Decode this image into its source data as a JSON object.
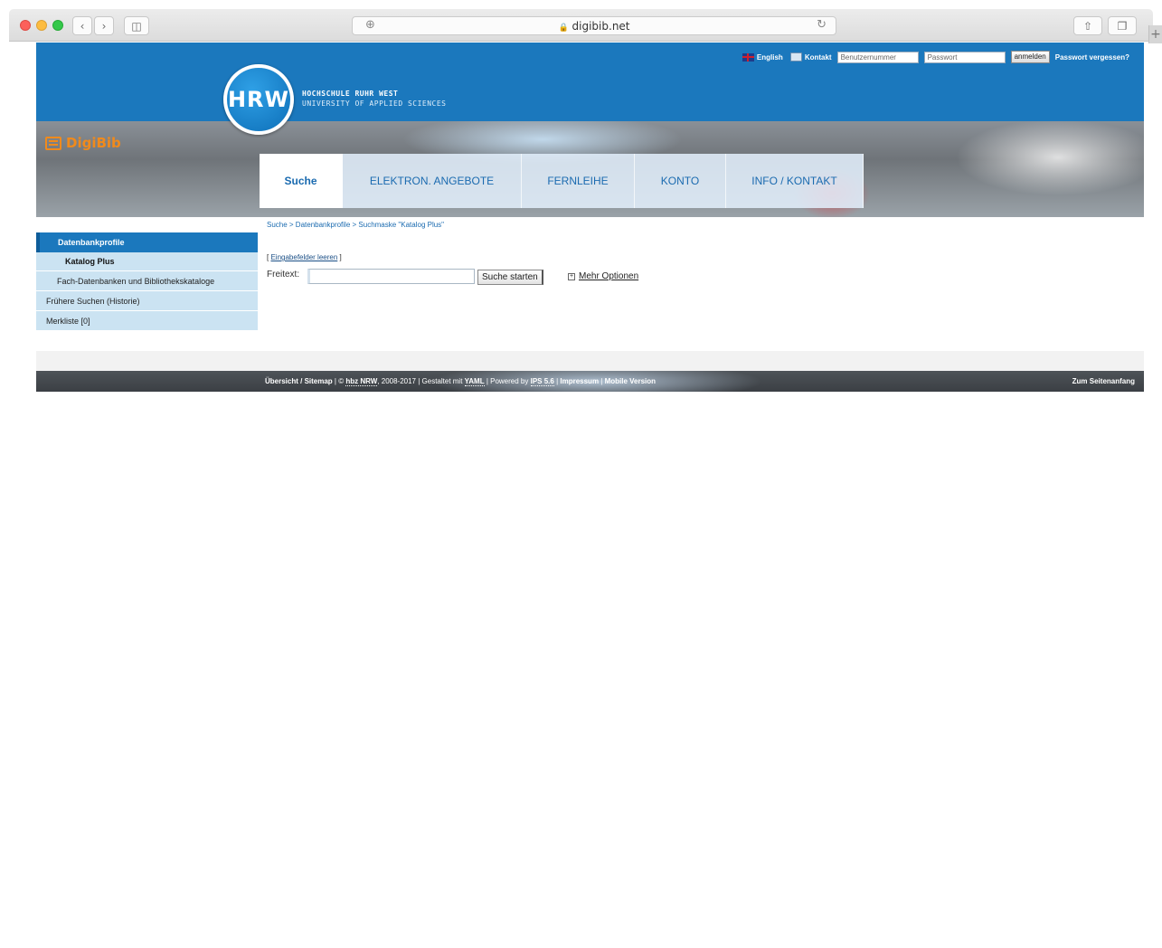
{
  "browser": {
    "url": "digibib.net",
    "lock": "🔒"
  },
  "header": {
    "logo_text": "HRW",
    "university_name": "HOCHSCHULE RUHR WEST",
    "university_sub": "UNIVERSITY OF APPLIED SCIENCES",
    "brand": "DigiBib",
    "english": "English",
    "kontakt": "Kontakt",
    "username_placeholder": "Benutzernummer",
    "password_placeholder": "Passwort",
    "login_button": "anmelden",
    "forgot_password": "Passwort vergessen?"
  },
  "nav": {
    "tabs": [
      {
        "label": "Suche"
      },
      {
        "label": "ELEKTRON. ANGEBOTE"
      },
      {
        "label": "FERNLEIHE"
      },
      {
        "label": "KONTO"
      },
      {
        "label": "INFO / KONTAKT"
      }
    ]
  },
  "breadcrumb": "Suche > Datenbankprofile > Suchmaske \"Katalog Plus\"",
  "sidebar": {
    "heading": "Datenbankprofile",
    "items": [
      {
        "label": "Katalog Plus"
      },
      {
        "label": "Fach-Datenbanken und Bibliothekskataloge"
      },
      {
        "label": "Frühere Suchen (Historie)"
      },
      {
        "label": "Merkliste [0]"
      }
    ]
  },
  "search": {
    "clear_prefix": "[ ",
    "clear_link": "Eingabefelder leeren",
    "clear_suffix": " ]",
    "label": "Freitext:",
    "value": "",
    "button": "Suche starten",
    "more_options": "Mehr Optionen"
  },
  "footer": {
    "overview": "Übersicht / Sitemap",
    "sep1": " | © ",
    "hbz": "hbz NRW",
    "years": ", 2008-2017 | Gestaltet mit ",
    "yaml": "YAML",
    "powered": " | Powered by ",
    "ips": "IPS 5.6",
    "sep2": " | ",
    "impressum": "Impressum",
    "sep3": " | ",
    "mobile": "Mobile Version",
    "to_top": "Zum Seitenanfang"
  }
}
